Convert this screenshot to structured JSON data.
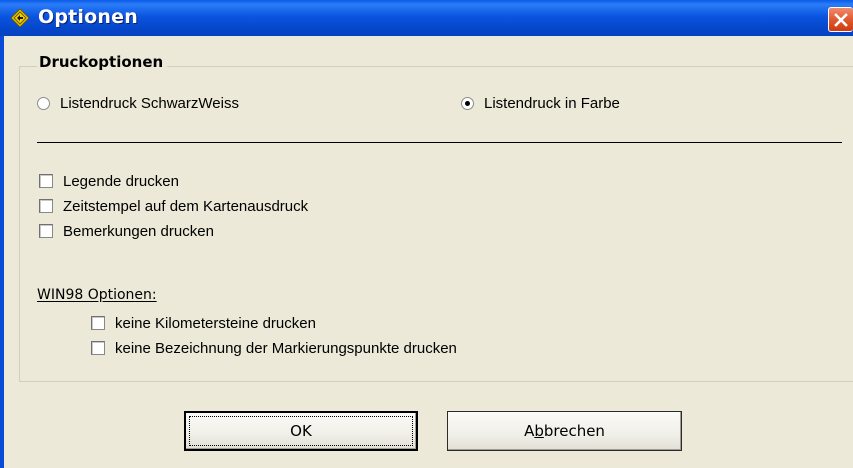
{
  "window": {
    "title": "Optionen",
    "app_icon": "yellow-diamond-icon",
    "close_icon": "close-icon",
    "titlebar_color": "#0a5be8",
    "close_color": "#e05a30"
  },
  "group": {
    "title": "Druckoptionen"
  },
  "print_mode": {
    "options": [
      {
        "label": "Listendruck SchwarzWeiss",
        "checked": false
      },
      {
        "label": "Listendruck in Farbe",
        "checked": true
      }
    ]
  },
  "checkboxes": [
    {
      "label": "Legende drucken",
      "checked": false
    },
    {
      "label": "Zeitstempel auf dem Kartenausdruck",
      "checked": false
    },
    {
      "label": "Bemerkungen drucken",
      "checked": false
    }
  ],
  "win98": {
    "label": "WIN98 Optionen:",
    "options": [
      {
        "label": "keine Kilometersteine drucken",
        "checked": false
      },
      {
        "label": "keine Bezeichnung der Markierungspunkte drucken",
        "checked": false
      }
    ]
  },
  "buttons": {
    "ok": "OK",
    "cancel_pre": "A",
    "cancel_mnemonic": "b",
    "cancel_post": "brechen"
  }
}
